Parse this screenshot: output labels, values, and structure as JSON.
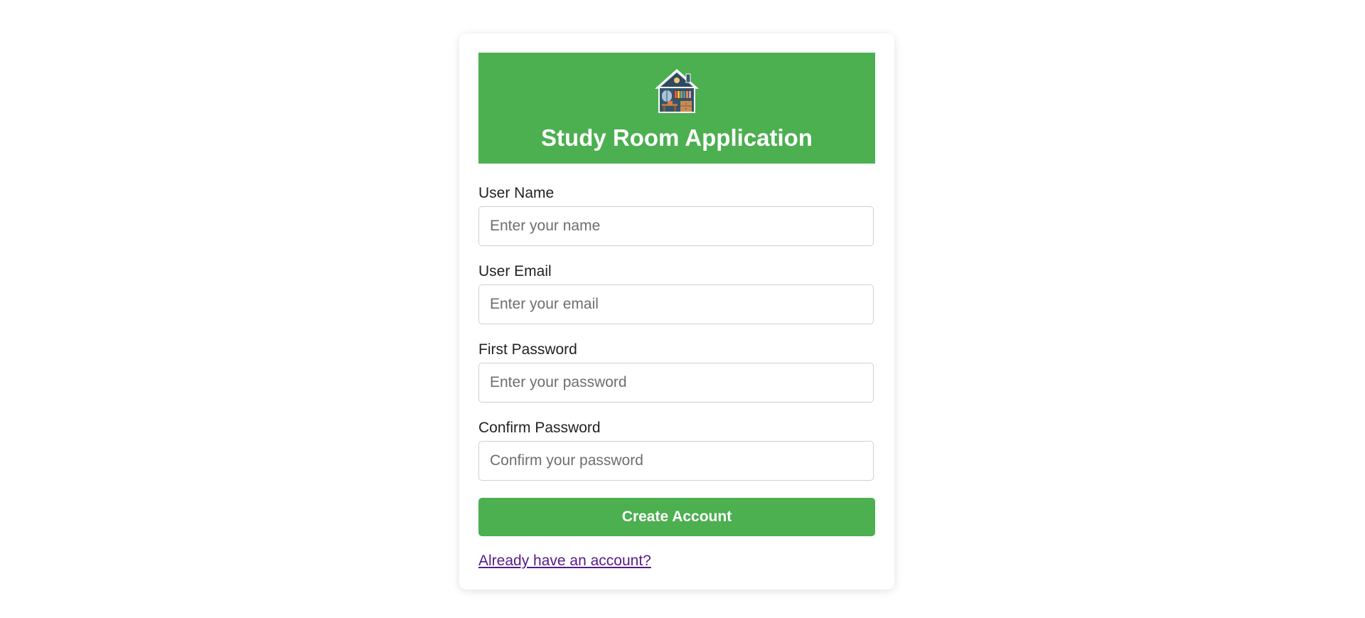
{
  "header": {
    "logo_icon": "house-icon",
    "title": "Study Room Application",
    "background_color": "#4caf50"
  },
  "form": {
    "fields": [
      {
        "label": "User Name",
        "placeholder": "Enter your name",
        "value": ""
      },
      {
        "label": "User Email",
        "placeholder": "Enter your email",
        "value": ""
      },
      {
        "label": "First Password",
        "placeholder": "Enter your password",
        "value": ""
      },
      {
        "label": "Confirm Password",
        "placeholder": "Confirm your password",
        "value": ""
      }
    ],
    "submit_label": "Create Account",
    "login_link": "Already have an account?"
  },
  "colors": {
    "accent": "#4caf50",
    "link": "#551a8b"
  }
}
